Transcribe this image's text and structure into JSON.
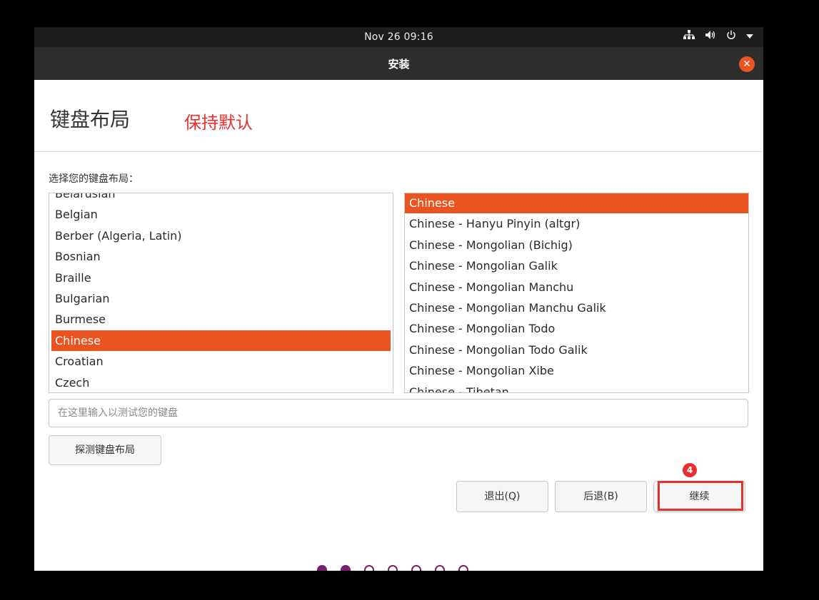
{
  "topbar": {
    "clock": "Nov 26  09:16",
    "tray_icons": [
      "network-icon",
      "volume-icon",
      "power-icon",
      "dropdown-arrow-icon"
    ]
  },
  "window": {
    "title": "安装",
    "close_glyph": "✕"
  },
  "page": {
    "heading": "键盘布局",
    "annotation": "保持默认",
    "prompt": "选择您的键盘布局："
  },
  "layouts": [
    {
      "label": "Belarusian",
      "selected": false
    },
    {
      "label": "Belgian",
      "selected": false
    },
    {
      "label": "Berber (Algeria, Latin)",
      "selected": false
    },
    {
      "label": "Bosnian",
      "selected": false
    },
    {
      "label": "Braille",
      "selected": false
    },
    {
      "label": "Bulgarian",
      "selected": false
    },
    {
      "label": "Burmese",
      "selected": false
    },
    {
      "label": "Chinese",
      "selected": true
    },
    {
      "label": "Croatian",
      "selected": false
    },
    {
      "label": "Czech",
      "selected": false
    }
  ],
  "variants": [
    {
      "label": "Chinese",
      "selected": true
    },
    {
      "label": "Chinese - Hanyu Pinyin (altgr)",
      "selected": false
    },
    {
      "label": "Chinese - Mongolian (Bichig)",
      "selected": false
    },
    {
      "label": "Chinese - Mongolian Galik",
      "selected": false
    },
    {
      "label": "Chinese - Mongolian Manchu",
      "selected": false
    },
    {
      "label": "Chinese - Mongolian Manchu Galik",
      "selected": false
    },
    {
      "label": "Chinese - Mongolian Todo",
      "selected": false
    },
    {
      "label": "Chinese - Mongolian Todo Galik",
      "selected": false
    },
    {
      "label": "Chinese - Mongolian Xibe",
      "selected": false
    },
    {
      "label": "Chinese - Tibetan",
      "selected": false
    }
  ],
  "test_input": {
    "placeholder": "在这里输入以测试您的键盘",
    "value": ""
  },
  "buttons": {
    "detect": "探测键盘布局",
    "quit": "退出(Q)",
    "back": "后退(B)",
    "continue": "继续"
  },
  "annotation_badge": "4",
  "progress": {
    "total_steps": 7,
    "completed_steps": 2
  },
  "colors": {
    "accent": "#e95420",
    "annotation_red": "#e8312f",
    "progress_purple": "#77216f"
  }
}
